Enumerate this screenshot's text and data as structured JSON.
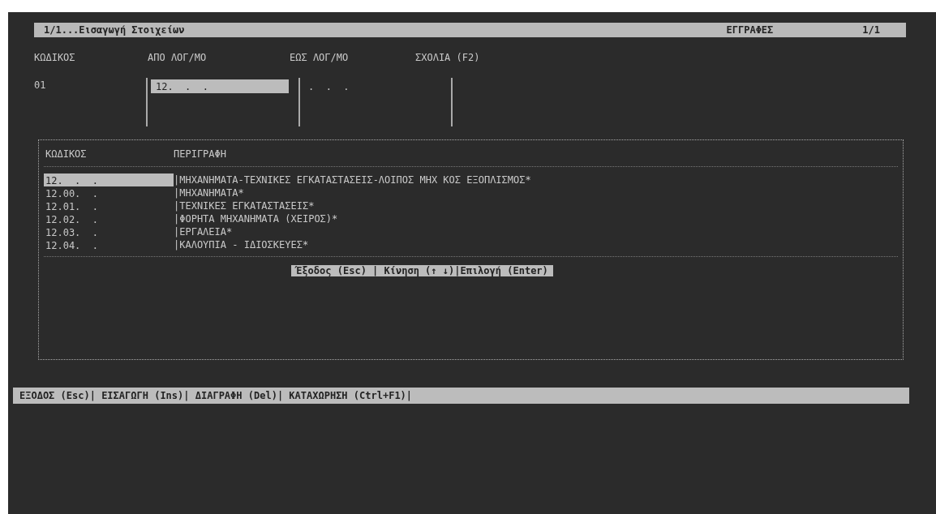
{
  "window": {
    "title": "1/1...Εισαγωγή Στοιχείων",
    "section": "ΕΓΓΡΑΦΕΣ",
    "page": "1/1"
  },
  "form": {
    "columns": [
      "ΚΩΔΙΚΟΣ",
      "ΑΠΟ ΛΟΓ/ΜΟ",
      "ΕΩΣ ΛΟΓ/ΜΟ",
      "ΣΧΟΛΙΑ (F2)"
    ],
    "row": {
      "code": "01",
      "from": {
        "value": "12.  .  .",
        "selected": true
      },
      "to": {
        "value": ".  .  .",
        "selected": false
      }
    }
  },
  "lookup": {
    "columns": [
      "ΚΩΔΙΚΟΣ",
      "ΠΕΡΙΓΡΑΦΗ"
    ],
    "rows": [
      {
        "code": "12.  .  .",
        "description": "|ΜΗΧΑΝΗΜΑΤΑ-ΤΕΧΝΙΚΕΣ ΕΓΚΑΤΑΣΤΑΣΕΙΣ-ΛΟΙΠΟΣ ΜΗΧ ΚΟΣ ΕΞΟΠΛΙΣΜΟΣ*",
        "selected": true
      },
      {
        "code": "12.00.  .",
        "description": "|ΜΗΧΑΝΗΜΑΤΑ*",
        "selected": false
      },
      {
        "code": "12.01.  .",
        "description": "|ΤΕΧΝΙΚΕΣ ΕΓΚΑΤΑΣΤΑΣΕΙΣ*",
        "selected": false
      },
      {
        "code": "12.02.  .",
        "description": "|ΦΟΡΗΤΑ ΜΗΧΑΝΗΜΑΤΑ (ΧΕΙΡΟΣ)*",
        "selected": false
      },
      {
        "code": "12.03.  .",
        "description": "|ΕΡΓΑΛΕΙΑ*",
        "selected": false
      },
      {
        "code": "12.04.  .",
        "description": "|ΚΑΛΟΥΠΙΑ - ΙΔΙΟΣΚΕΥΕΣ*",
        "selected": false
      }
    ],
    "hint": "Έξοδος (Esc) | Κίνηση (↑ ↓)|Επιλογή (Enter)"
  },
  "status_bar": "ΕΞΟΔΟΣ (Esc)| ΕΙΣΑΓΩΓΗ (Ins)| ΔΙΑΓΡΑΦΗ (Del)| ΚΑΤΑΧΩΡΗΣΗ (Ctrl+F1)|"
}
